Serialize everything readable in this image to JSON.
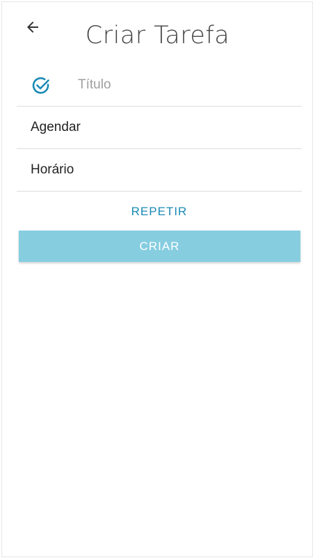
{
  "header": {
    "back_icon": "arrow-left-icon",
    "title": "Criar Tarefa"
  },
  "form": {
    "title_icon": "check-circle-icon",
    "title_placeholder": "Título",
    "title_value": "",
    "schedule_label": "Agendar",
    "time_label": "Horário",
    "repeat_label": "REPETIR",
    "create_label": "CRIAR"
  },
  "colors": {
    "accent": "#1a8ab5",
    "create_button": "#86cde0",
    "title_text": "#444444"
  }
}
